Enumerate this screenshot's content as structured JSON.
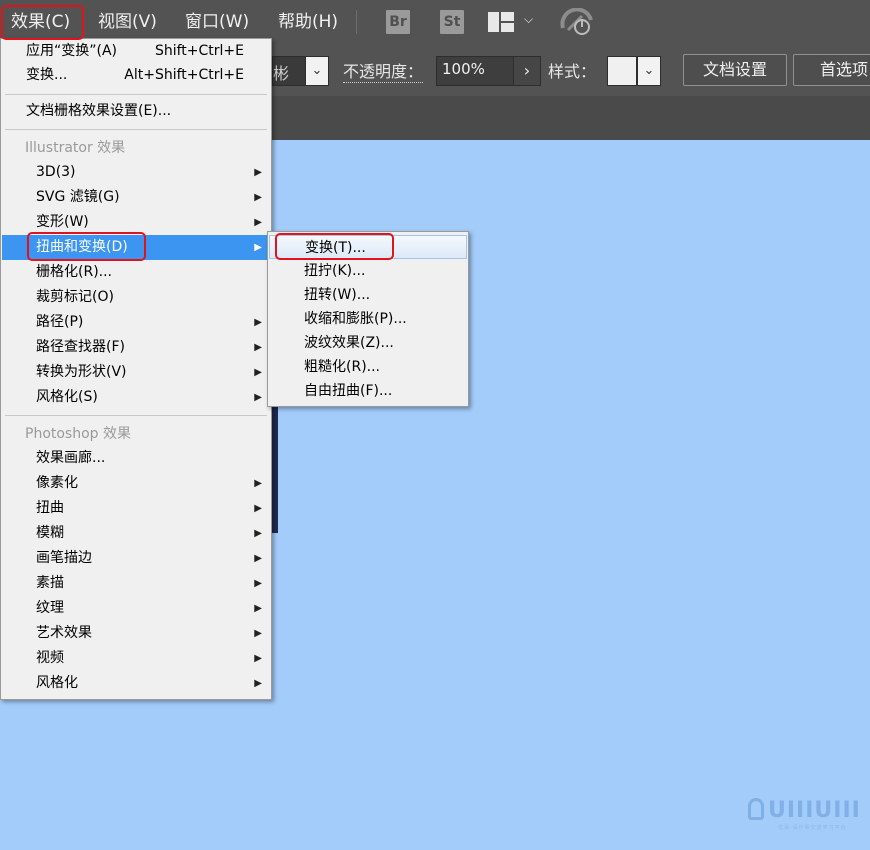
{
  "menubar": {
    "items": [
      {
        "label": "效果(C)"
      },
      {
        "label": "视图(V)"
      },
      {
        "label": "窗口(W)"
      },
      {
        "label": "帮助(H)"
      }
    ],
    "icons": {
      "br": "Br",
      "st": "St"
    }
  },
  "control_bar": {
    "shape_fragment": "彬",
    "opacity_label": "不透明度：",
    "opacity_value": "100%",
    "style_label": "样式：",
    "doc_settings": "文档设置",
    "preferences": "首选项"
  },
  "effect_menu": {
    "apply_last": {
      "label": "应用“变换”(A)",
      "shortcut": "Shift+Ctrl+E"
    },
    "last_effect": {
      "label": "变换...",
      "shortcut": "Alt+Shift+Ctrl+E"
    },
    "raster_settings": "文档栅格效果设置(E)...",
    "illustrator_header": "Illustrator 效果",
    "illustrator_items": [
      "3D(3)",
      "SVG 滤镜(G)",
      "变形(W)",
      "扭曲和变换(D)",
      "栅格化(R)...",
      "裁剪标记(O)",
      "路径(P)",
      "路径查找器(F)",
      "转换为形状(V)",
      "风格化(S)"
    ],
    "photoshop_header": "Photoshop 效果",
    "photoshop_items": [
      "效果画廊...",
      "像素化",
      "扭曲",
      "模糊",
      "画笔描边",
      "素描",
      "纹理",
      "艺术效果",
      "视频",
      "风格化"
    ]
  },
  "distort_submenu": {
    "items": [
      "变换(T)...",
      "扭拧(K)...",
      "扭转(W)...",
      "收缩和膨胀(P)...",
      "波纹效果(Z)...",
      "粗糙化(R)...",
      "自由扭曲(F)..."
    ]
  },
  "watermark": {
    "text": "UIIIUIII",
    "tagline": "优设·设计师交流学习平台"
  },
  "colors": {
    "highlight": "#3c95f0",
    "annotation": "#e0141c",
    "canvas": "#a3ccfa",
    "chrome": "#535353"
  }
}
